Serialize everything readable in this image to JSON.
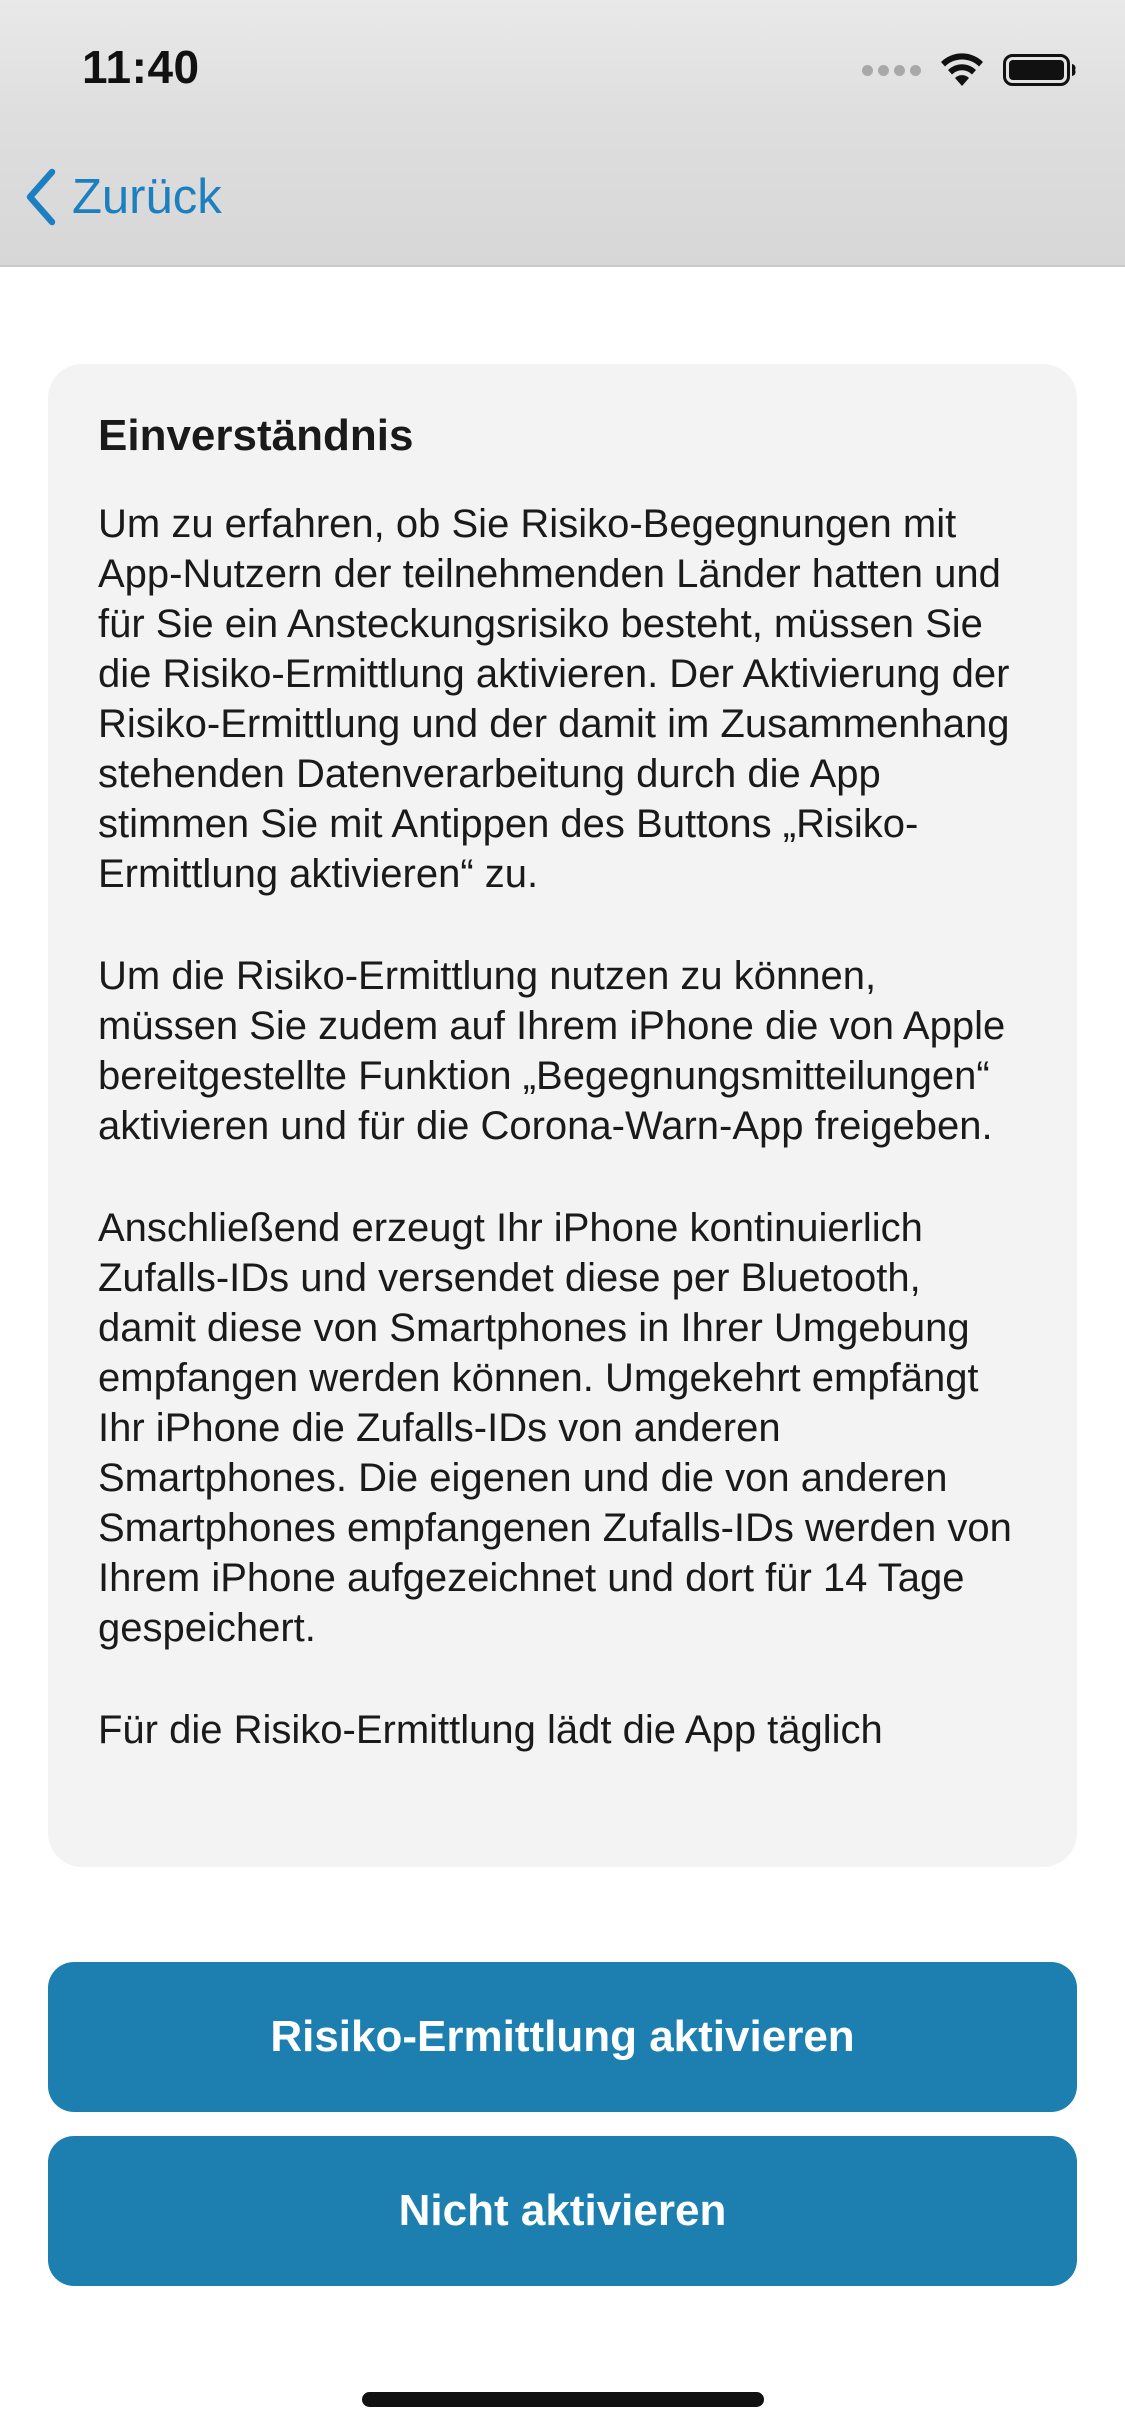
{
  "status_bar": {
    "time": "11:40",
    "icons": [
      "cellular-signal-icon",
      "wifi-icon",
      "battery-icon"
    ]
  },
  "nav": {
    "back_label": "Zurück",
    "back_icon": "chevron-left-icon"
  },
  "consent": {
    "title": "Einverständnis",
    "paragraphs": [
      "Um zu erfahren, ob Sie Risiko-Begegnungen mit App-Nutzern der teilnehmenden Länder hatten und für Sie ein Ansteckungsrisiko besteht, müssen Sie die Risiko-Ermittlung aktivieren. Der Aktivierung der Risiko-Ermittlung und der damit im Zusammenhang stehenden Datenverarbeitung durch die App stimmen Sie mit Antippen des Buttons „Risiko-Ermittlung aktivieren“ zu.",
      "Um die Risiko-Ermittlung nutzen zu können, müssen Sie zudem auf Ihrem iPhone die von Apple bereitgestellte Funktion „Begegnungsmitteilungen“ aktivieren und für die Corona-Warn-App freigeben.",
      "Anschließend erzeugt Ihr iPhone kontinuierlich Zufalls-IDs und versendet diese per Bluetooth, damit diese von Smartphones in Ihrer Umgebung empfangen werden können. Umgekehrt empfängt Ihr iPhone die Zufalls-IDs von anderen Smartphones. Die eigenen und die von anderen Smartphones empfangenen Zufalls-IDs werden von Ihrem iPhone aufgezeichnet und dort für 14 Tage gespeichert.",
      "Für die Risiko-Ermittlung lädt die App täglich"
    ]
  },
  "buttons": {
    "activate_label": "Risiko-Ermittlung aktivieren",
    "decline_label": "Nicht aktivieren"
  },
  "colors": {
    "accent": "#1c7fb0",
    "link": "#1c7fbf",
    "card_background": "#f3f3f3"
  }
}
